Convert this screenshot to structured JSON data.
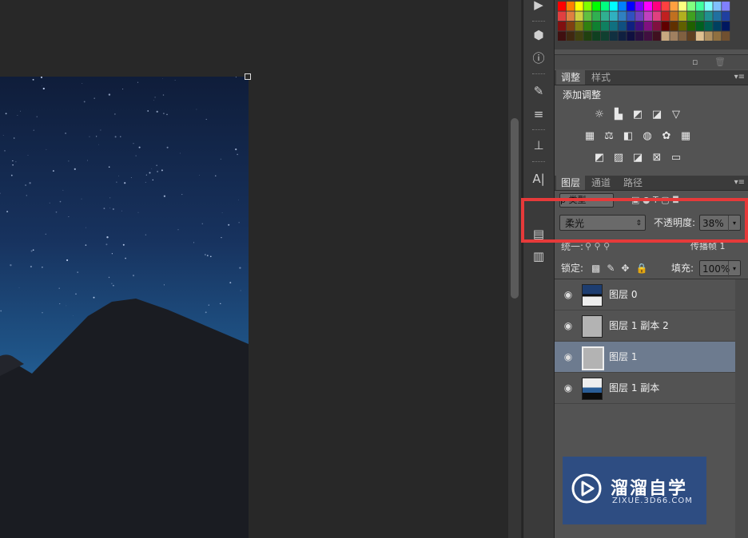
{
  "colors": {
    "selection_red": "#e63a3a",
    "layer_selected": "#6d7b8f",
    "watermark_bg": "#2e4d82"
  },
  "adjust_panel": {
    "tabs": [
      {
        "label": "调整",
        "active": true
      },
      {
        "label": "样式",
        "active": false
      }
    ],
    "heading": "添加调整",
    "icons_row1": [
      "brightness-icon",
      "levels-icon",
      "curves-icon",
      "exposure-icon",
      "vibrance-icon"
    ],
    "icons_row2": [
      "hue-icon",
      "balance-icon",
      "bw-icon",
      "photo-filter-icon",
      "channel-mixer-icon",
      "lookup-icon"
    ],
    "icons_row3": [
      "invert-icon",
      "posterize-icon",
      "threshold-icon",
      "selective-color-icon",
      "gradient-map-icon"
    ]
  },
  "layers_panel": {
    "tabs": [
      {
        "label": "图层",
        "active": true
      },
      {
        "label": "通道",
        "active": false
      },
      {
        "label": "路径",
        "active": false
      }
    ],
    "kind_filter": "ρ 类型",
    "blend_mode": "柔光",
    "opacity_label": "不透明度:",
    "opacity_value": "38%",
    "unify_label": "统一:",
    "propagate_label": "传播帧 1",
    "lock_label": "锁定:",
    "fill_label": "填充:",
    "fill_value": "100%",
    "layers": [
      {
        "name": "图层 0",
        "selected": false,
        "thumb": "night-top"
      },
      {
        "name": "图层 1 副本 2",
        "selected": false,
        "thumb": "gray"
      },
      {
        "name": "图层 1",
        "selected": true,
        "thumb": "gray"
      },
      {
        "name": "图层 1 副本",
        "selected": false,
        "thumb": "night-bottom"
      }
    ]
  },
  "watermark": {
    "title": "溜溜自学",
    "url": "ZIXUE.3D66.COM"
  }
}
